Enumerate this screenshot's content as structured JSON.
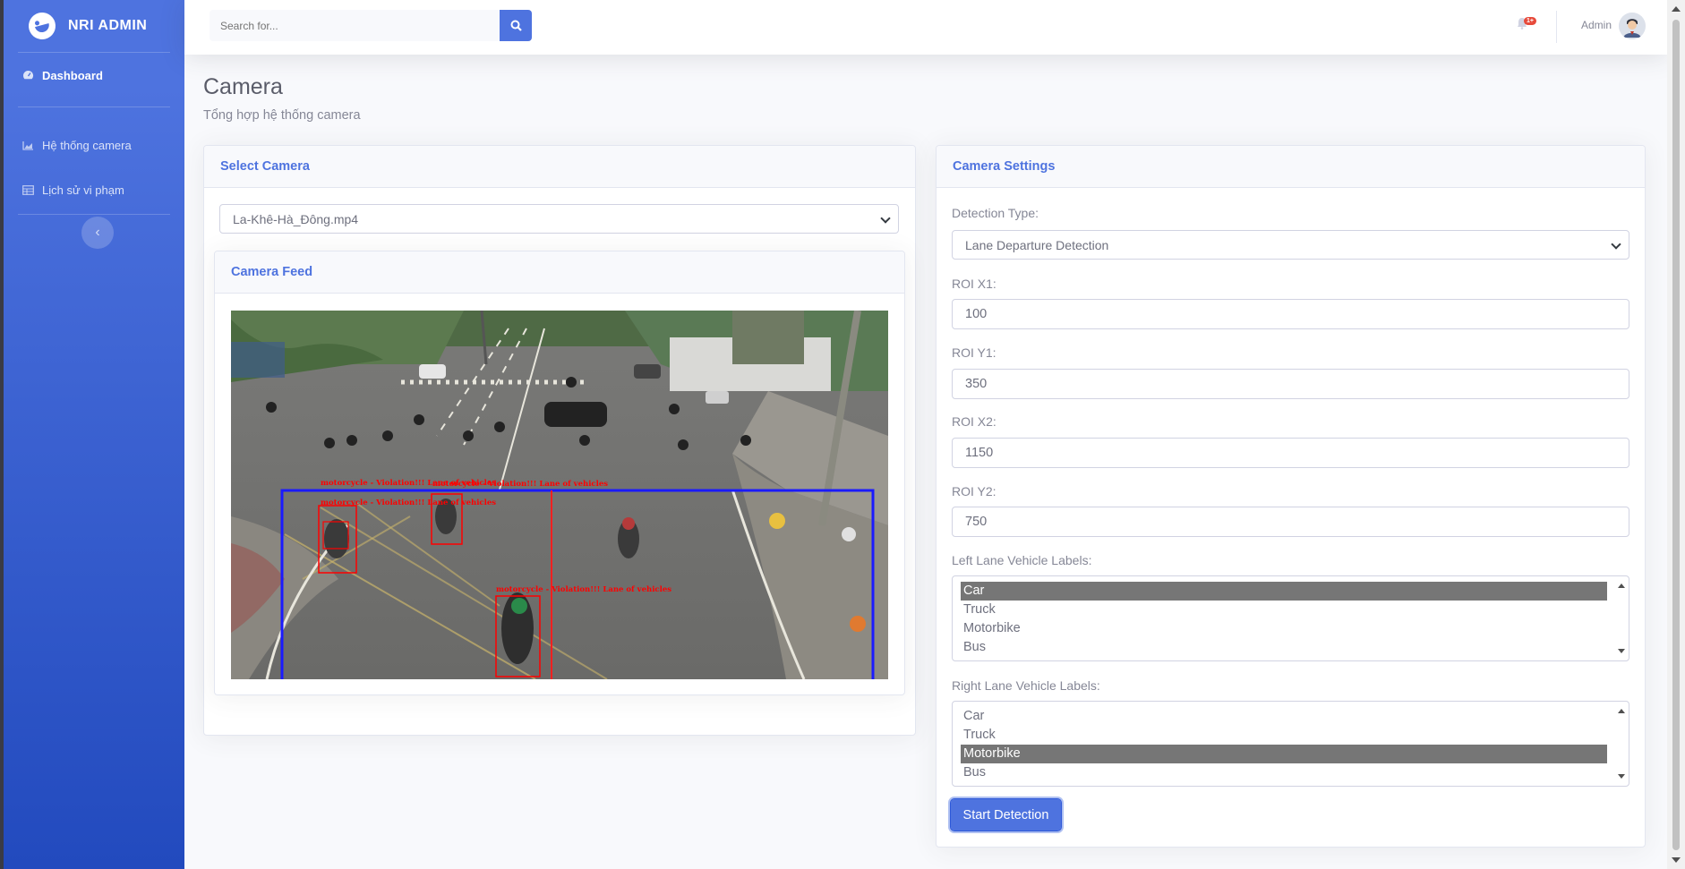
{
  "sidebar": {
    "brand": "NRI ADMIN",
    "items": [
      {
        "label": "Dashboard",
        "icon": "tachometer-icon"
      },
      {
        "label": "Hệ thống camera",
        "icon": "chart-area-icon"
      },
      {
        "label": "Lịch sử vi phạm",
        "icon": "table-icon"
      }
    ]
  },
  "topbar": {
    "search_placeholder": "Search for...",
    "alert_badge": "1+",
    "user_name": "Admin"
  },
  "page": {
    "title": "Camera",
    "subtitle": "Tổng hợp hệ thống camera"
  },
  "select_camera": {
    "header": "Select Camera",
    "selected": "La-Khê-Hà_Đông.mp4"
  },
  "camera_feed": {
    "header": "Camera Feed",
    "overlays": [
      "motorcycle - Violation!!! Lane of vehicles",
      "motorcycle - Violation!!! Lane of vehicles",
      "motorcycle - Violation!!! Lane of vehicles",
      "motorcycle - Violation!!! Lane of vehicles"
    ]
  },
  "settings": {
    "header": "Camera Settings",
    "detection_type_label": "Detection Type:",
    "detection_type": "Lane Departure Detection",
    "roi_x1_label": "ROI X1:",
    "roi_x1": "100",
    "roi_y1_label": "ROI Y1:",
    "roi_y1": "350",
    "roi_x2_label": "ROI X2:",
    "roi_x2": "1150",
    "roi_y2_label": "ROI Y2:",
    "roi_y2": "750",
    "left_lane_label": "Left Lane Vehicle Labels:",
    "left_lane_options": [
      "Car",
      "Truck",
      "Motorbike",
      "Bus"
    ],
    "left_lane_selected": "Car",
    "right_lane_label": "Right Lane Vehicle Labels:",
    "right_lane_options": [
      "Car",
      "Truck",
      "Motorbike",
      "Bus"
    ],
    "right_lane_selected": "Motorbike",
    "start_button": "Start Detection"
  },
  "colors": {
    "primary": "#4e73df",
    "danger": "#e74a3b",
    "roi_box": "#1a1aff",
    "violation": "#ff0000"
  }
}
